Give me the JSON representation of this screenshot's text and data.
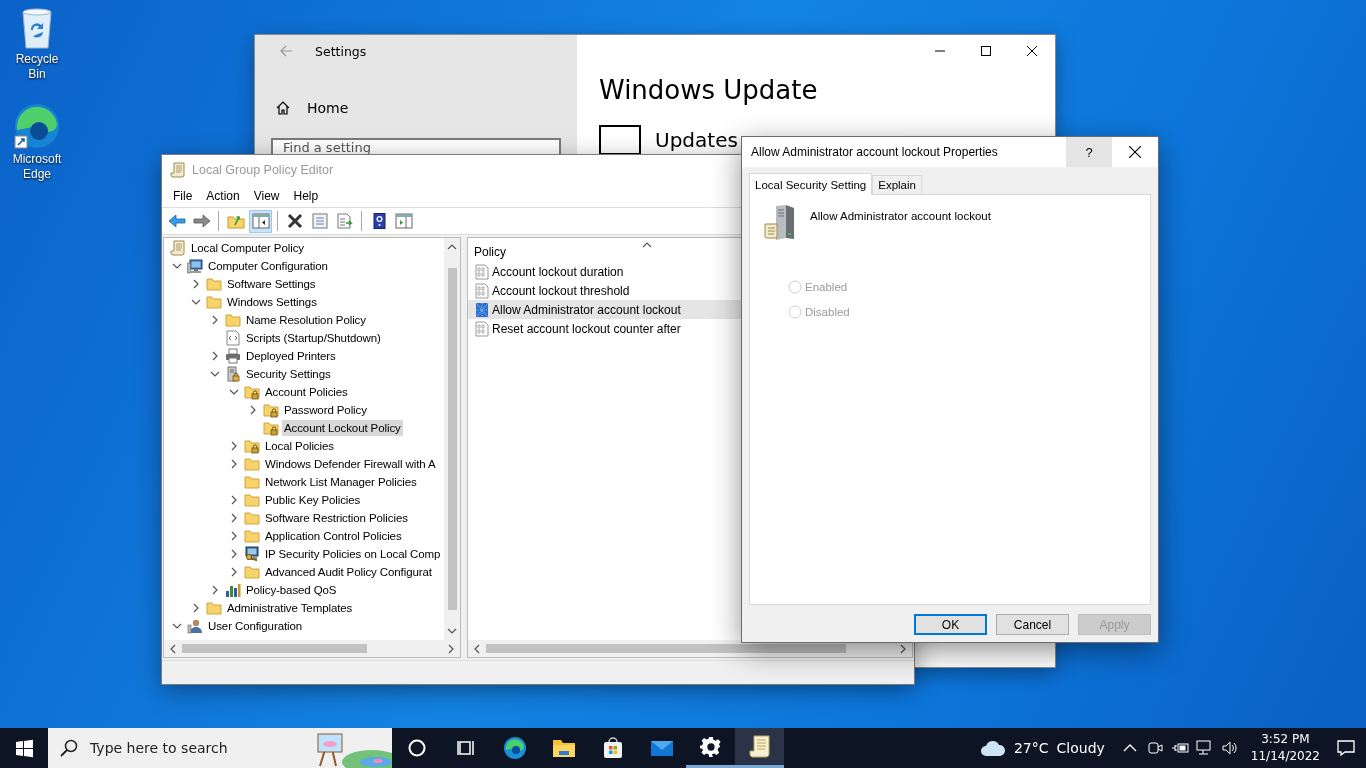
{
  "desktop_icons": [
    {
      "label": "Recycle Bin",
      "kind": "recycle"
    },
    {
      "label": "Microsoft Edge",
      "kind": "edge"
    }
  ],
  "settings_window": {
    "title": "Settings",
    "nav_item": "Home",
    "search": {
      "placeholder": "Find a setting"
    },
    "heading": "Windows Update",
    "status": "Updates"
  },
  "gpe_window": {
    "title": "Local Group Policy Editor",
    "menu": [
      "File",
      "Action",
      "View",
      "Help"
    ],
    "toolbar": [
      {
        "kind": "back",
        "pressed": false
      },
      {
        "kind": "forward",
        "pressed": false
      },
      {
        "kind": "up",
        "pressed": false
      },
      {
        "kind": "pane",
        "pressed": true
      },
      {
        "kind": "delete",
        "pressed": false
      },
      {
        "kind": "properties",
        "pressed": false
      },
      {
        "kind": "export",
        "pressed": false
      },
      {
        "kind": "help",
        "pressed": false
      },
      {
        "kind": "action-pane",
        "pressed": false
      }
    ],
    "tree": [
      {
        "label": "Local Computer Policy",
        "kind": "scroll",
        "selected": false,
        "children": [
          {
            "label": "Computer Configuration",
            "kind": "computer",
            "expanded": true,
            "selected": false,
            "children": [
              {
                "label": "Software Settings",
                "kind": "folder",
                "expanded": false,
                "selected": false
              },
              {
                "label": "Windows Settings",
                "kind": "folder",
                "expanded": true,
                "selected": false,
                "children": [
                  {
                    "label": "Name Resolution Policy",
                    "kind": "folder",
                    "expanded": false,
                    "selected": false
                  },
                  {
                    "label": "Scripts (Startup/Shutdown)",
                    "kind": "script",
                    "selected": false
                  },
                  {
                    "label": "Deployed Printers",
                    "kind": "printer",
                    "expanded": false,
                    "selected": false
                  },
                  {
                    "label": "Security Settings",
                    "kind": "security",
                    "expanded": true,
                    "selected": false,
                    "children": [
                      {
                        "label": "Account Policies",
                        "kind": "lockfolder",
                        "expanded": true,
                        "selected": false,
                        "children": [
                          {
                            "label": "Password Policy",
                            "kind": "lockfolder",
                            "expanded": false,
                            "selected": false
                          },
                          {
                            "label": "Account Lockout Policy",
                            "kind": "lockfolder",
                            "selected": true
                          }
                        ]
                      },
                      {
                        "label": "Local Policies",
                        "kind": "lockfolder",
                        "expanded": false,
                        "selected": false
                      },
                      {
                        "label": "Windows Defender Firewall with A",
                        "kind": "folder",
                        "expanded": false,
                        "selected": false
                      },
                      {
                        "label": "Network List Manager Policies",
                        "kind": "folder",
                        "selected": false
                      },
                      {
                        "label": "Public Key Policies",
                        "kind": "folder",
                        "expanded": false,
                        "selected": false
                      },
                      {
                        "label": "Software Restriction Policies",
                        "kind": "folder",
                        "expanded": false,
                        "selected": false
                      },
                      {
                        "label": "Application Control Policies",
                        "kind": "folder",
                        "expanded": false,
                        "selected": false
                      },
                      {
                        "label": "IP Security Policies on Local Comp",
                        "kind": "ipsec",
                        "expanded": false,
                        "selected": false
                      },
                      {
                        "label": "Advanced Audit Policy Configurat",
                        "kind": "folder",
                        "expanded": false,
                        "selected": false
                      }
                    ]
                  },
                  {
                    "label": "Policy-based QoS",
                    "kind": "chart",
                    "expanded": false,
                    "selected": false
                  }
                ]
              },
              {
                "label": "Administrative Templates",
                "kind": "folder",
                "expanded": false,
                "selected": false
              }
            ]
          },
          {
            "label": "User Configuration",
            "kind": "user",
            "expanded": true,
            "selected": false
          }
        ]
      }
    ],
    "list": {
      "column": "Policy",
      "items": [
        {
          "label": "Account lockout duration",
          "selected": false
        },
        {
          "label": "Account lockout threshold",
          "selected": false
        },
        {
          "label": "Allow Administrator account lockout",
          "selected": true
        },
        {
          "label": "Reset account lockout counter after",
          "selected": false
        }
      ]
    }
  },
  "dialog": {
    "title": "Allow Administrator account lockout Properties",
    "help_button": {
      "label": "?",
      "hovered": true
    },
    "tabs": [
      {
        "label": "Local Security Setting",
        "selected": true
      },
      {
        "label": "Explain",
        "selected": false
      }
    ],
    "setting_name": "Allow Administrator account lockout",
    "options": [
      {
        "label": "Enabled",
        "checked": false,
        "disabled": true
      },
      {
        "label": "Disabled",
        "checked": false,
        "disabled": true
      }
    ],
    "buttons": [
      {
        "label": "OK",
        "kind": "default"
      },
      {
        "label": "Cancel",
        "kind": "normal"
      },
      {
        "label": "Apply",
        "kind": "disabled"
      }
    ]
  },
  "taskbar": {
    "search_placeholder": "Type here to search",
    "apps": [
      {
        "kind": "cortana",
        "running": false,
        "active": false
      },
      {
        "kind": "task-view",
        "running": false,
        "active": false
      },
      {
        "kind": "edge",
        "running": false,
        "active": false
      },
      {
        "kind": "explorer",
        "running": false,
        "active": false
      },
      {
        "kind": "store",
        "running": false,
        "active": false
      },
      {
        "kind": "mail",
        "running": false,
        "active": false
      },
      {
        "kind": "gear",
        "running": true,
        "active": false
      },
      {
        "kind": "scroll",
        "running": true,
        "active": true
      }
    ],
    "weather": {
      "temperature": "27°C",
      "condition": "Cloudy"
    },
    "time": "3:52 PM",
    "date": "11/14/2022"
  }
}
